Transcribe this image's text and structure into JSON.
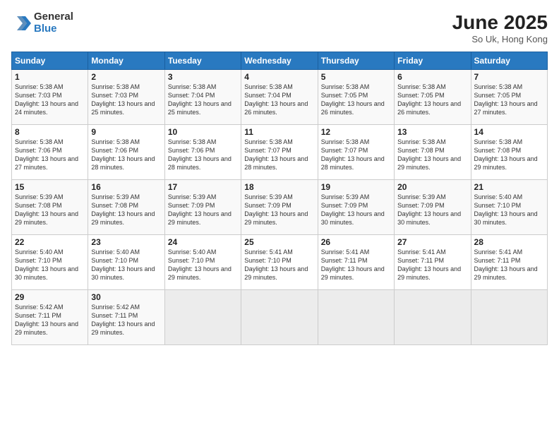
{
  "logo": {
    "general": "General",
    "blue": "Blue"
  },
  "header": {
    "month_year": "June 2025",
    "location": "So Uk, Hong Kong"
  },
  "weekdays": [
    "Sunday",
    "Monday",
    "Tuesday",
    "Wednesday",
    "Thursday",
    "Friday",
    "Saturday"
  ],
  "weeks": [
    [
      {
        "day": "1",
        "sunrise": "Sunrise: 5:38 AM",
        "sunset": "Sunset: 7:03 PM",
        "daylight": "Daylight: 13 hours and 24 minutes."
      },
      {
        "day": "2",
        "sunrise": "Sunrise: 5:38 AM",
        "sunset": "Sunset: 7:03 PM",
        "daylight": "Daylight: 13 hours and 25 minutes."
      },
      {
        "day": "3",
        "sunrise": "Sunrise: 5:38 AM",
        "sunset": "Sunset: 7:04 PM",
        "daylight": "Daylight: 13 hours and 25 minutes."
      },
      {
        "day": "4",
        "sunrise": "Sunrise: 5:38 AM",
        "sunset": "Sunset: 7:04 PM",
        "daylight": "Daylight: 13 hours and 26 minutes."
      },
      {
        "day": "5",
        "sunrise": "Sunrise: 5:38 AM",
        "sunset": "Sunset: 7:05 PM",
        "daylight": "Daylight: 13 hours and 26 minutes."
      },
      {
        "day": "6",
        "sunrise": "Sunrise: 5:38 AM",
        "sunset": "Sunset: 7:05 PM",
        "daylight": "Daylight: 13 hours and 26 minutes."
      },
      {
        "day": "7",
        "sunrise": "Sunrise: 5:38 AM",
        "sunset": "Sunset: 7:05 PM",
        "daylight": "Daylight: 13 hours and 27 minutes."
      }
    ],
    [
      {
        "day": "8",
        "sunrise": "Sunrise: 5:38 AM",
        "sunset": "Sunset: 7:06 PM",
        "daylight": "Daylight: 13 hours and 27 minutes."
      },
      {
        "day": "9",
        "sunrise": "Sunrise: 5:38 AM",
        "sunset": "Sunset: 7:06 PM",
        "daylight": "Daylight: 13 hours and 28 minutes."
      },
      {
        "day": "10",
        "sunrise": "Sunrise: 5:38 AM",
        "sunset": "Sunset: 7:06 PM",
        "daylight": "Daylight: 13 hours and 28 minutes."
      },
      {
        "day": "11",
        "sunrise": "Sunrise: 5:38 AM",
        "sunset": "Sunset: 7:07 PM",
        "daylight": "Daylight: 13 hours and 28 minutes."
      },
      {
        "day": "12",
        "sunrise": "Sunrise: 5:38 AM",
        "sunset": "Sunset: 7:07 PM",
        "daylight": "Daylight: 13 hours and 28 minutes."
      },
      {
        "day": "13",
        "sunrise": "Sunrise: 5:38 AM",
        "sunset": "Sunset: 7:08 PM",
        "daylight": "Daylight: 13 hours and 29 minutes."
      },
      {
        "day": "14",
        "sunrise": "Sunrise: 5:38 AM",
        "sunset": "Sunset: 7:08 PM",
        "daylight": "Daylight: 13 hours and 29 minutes."
      }
    ],
    [
      {
        "day": "15",
        "sunrise": "Sunrise: 5:39 AM",
        "sunset": "Sunset: 7:08 PM",
        "daylight": "Daylight: 13 hours and 29 minutes."
      },
      {
        "day": "16",
        "sunrise": "Sunrise: 5:39 AM",
        "sunset": "Sunset: 7:08 PM",
        "daylight": "Daylight: 13 hours and 29 minutes."
      },
      {
        "day": "17",
        "sunrise": "Sunrise: 5:39 AM",
        "sunset": "Sunset: 7:09 PM",
        "daylight": "Daylight: 13 hours and 29 minutes."
      },
      {
        "day": "18",
        "sunrise": "Sunrise: 5:39 AM",
        "sunset": "Sunset: 7:09 PM",
        "daylight": "Daylight: 13 hours and 29 minutes."
      },
      {
        "day": "19",
        "sunrise": "Sunrise: 5:39 AM",
        "sunset": "Sunset: 7:09 PM",
        "daylight": "Daylight: 13 hours and 30 minutes."
      },
      {
        "day": "20",
        "sunrise": "Sunrise: 5:39 AM",
        "sunset": "Sunset: 7:09 PM",
        "daylight": "Daylight: 13 hours and 30 minutes."
      },
      {
        "day": "21",
        "sunrise": "Sunrise: 5:40 AM",
        "sunset": "Sunset: 7:10 PM",
        "daylight": "Daylight: 13 hours and 30 minutes."
      }
    ],
    [
      {
        "day": "22",
        "sunrise": "Sunrise: 5:40 AM",
        "sunset": "Sunset: 7:10 PM",
        "daylight": "Daylight: 13 hours and 30 minutes."
      },
      {
        "day": "23",
        "sunrise": "Sunrise: 5:40 AM",
        "sunset": "Sunset: 7:10 PM",
        "daylight": "Daylight: 13 hours and 30 minutes."
      },
      {
        "day": "24",
        "sunrise": "Sunrise: 5:40 AM",
        "sunset": "Sunset: 7:10 PM",
        "daylight": "Daylight: 13 hours and 29 minutes."
      },
      {
        "day": "25",
        "sunrise": "Sunrise: 5:41 AM",
        "sunset": "Sunset: 7:10 PM",
        "daylight": "Daylight: 13 hours and 29 minutes."
      },
      {
        "day": "26",
        "sunrise": "Sunrise: 5:41 AM",
        "sunset": "Sunset: 7:11 PM",
        "daylight": "Daylight: 13 hours and 29 minutes."
      },
      {
        "day": "27",
        "sunrise": "Sunrise: 5:41 AM",
        "sunset": "Sunset: 7:11 PM",
        "daylight": "Daylight: 13 hours and 29 minutes."
      },
      {
        "day": "28",
        "sunrise": "Sunrise: 5:41 AM",
        "sunset": "Sunset: 7:11 PM",
        "daylight": "Daylight: 13 hours and 29 minutes."
      }
    ],
    [
      {
        "day": "29",
        "sunrise": "Sunrise: 5:42 AM",
        "sunset": "Sunset: 7:11 PM",
        "daylight": "Daylight: 13 hours and 29 minutes."
      },
      {
        "day": "30",
        "sunrise": "Sunrise: 5:42 AM",
        "sunset": "Sunset: 7:11 PM",
        "daylight": "Daylight: 13 hours and 29 minutes."
      },
      {
        "day": "",
        "sunrise": "",
        "sunset": "",
        "daylight": ""
      },
      {
        "day": "",
        "sunrise": "",
        "sunset": "",
        "daylight": ""
      },
      {
        "day": "",
        "sunrise": "",
        "sunset": "",
        "daylight": ""
      },
      {
        "day": "",
        "sunrise": "",
        "sunset": "",
        "daylight": ""
      },
      {
        "day": "",
        "sunrise": "",
        "sunset": "",
        "daylight": ""
      }
    ]
  ]
}
